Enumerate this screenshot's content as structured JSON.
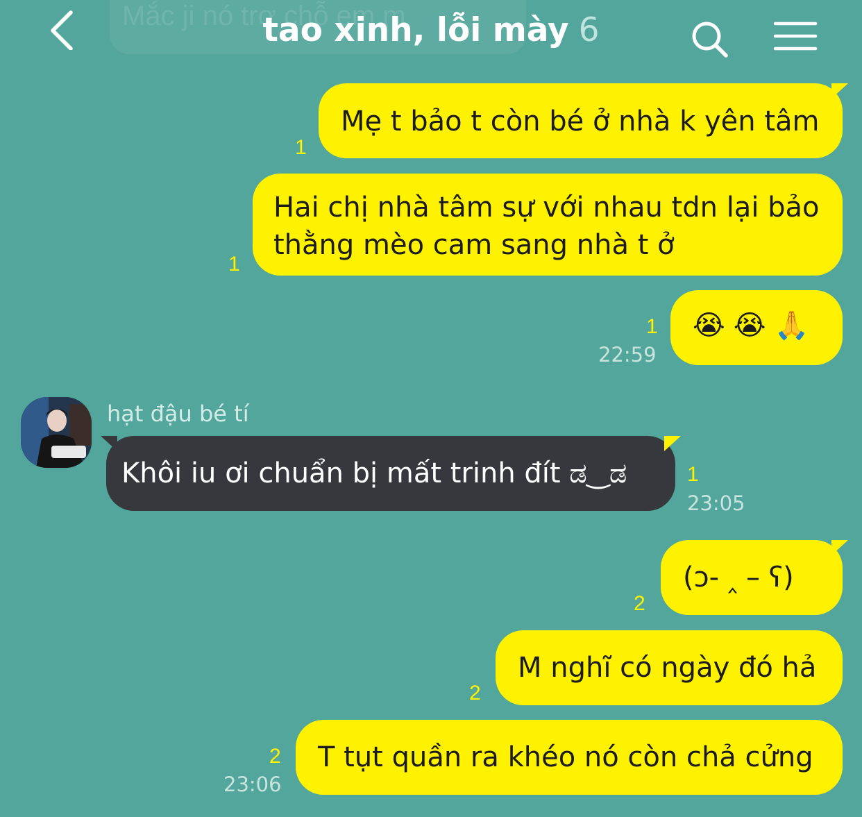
{
  "header": {
    "ghost_preview": "Mắc ji nó trơ chỗ em m",
    "title": "tao xinh, lỗi mày",
    "member_count": "6"
  },
  "messages": [
    {
      "id": "m1",
      "text": "Mẹ t bảo t còn bé ở nhà k yên tâm",
      "unread": "1",
      "time": ""
    },
    {
      "id": "m2",
      "text": "Hai chị nhà tâm sự với nhau tdn lại bảo thằng mèo cam sang nhà t ở",
      "unread": "1",
      "time": ""
    },
    {
      "id": "m3",
      "emojis": [
        "😭",
        "😭",
        "🙏"
      ],
      "unread": "1",
      "time": "22:59"
    },
    {
      "id": "m4",
      "sender": "hạt đậu bé tí",
      "text": "Khôi iu ơi chuẩn bị mất trinh đít ಡ‿ಡ",
      "unread": "1",
      "time": "23:05"
    },
    {
      "id": "m5",
      "text": "(ↄ- ‸ – ʕ)",
      "unread": "2",
      "time": ""
    },
    {
      "id": "m6",
      "text": "M nghĩ có ngày đó hả",
      "unread": "2",
      "time": ""
    },
    {
      "id": "m7",
      "text": "T tụt quần ra khéo nó còn chả cửng",
      "unread": "2",
      "time": "23:06"
    }
  ],
  "icons": {
    "back": "back-chevron-icon",
    "search": "search-icon",
    "menu": "hamburger-menu-icon"
  },
  "colors": {
    "background": "#53a69c",
    "outgoing_bubble": "#fff200",
    "incoming_bubble": "#36383d",
    "unread_count": "#fff200"
  }
}
